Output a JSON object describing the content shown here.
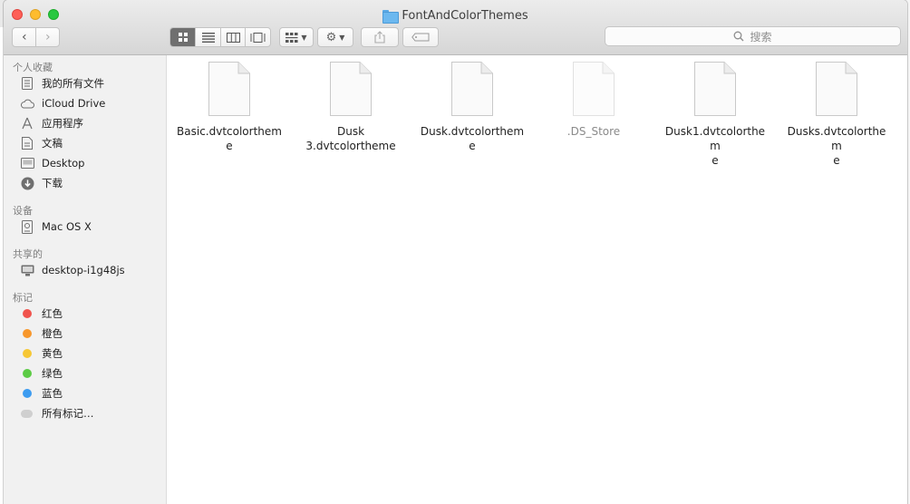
{
  "window": {
    "title": "FontAndColorThemes"
  },
  "toolbar": {
    "back_glyph": "‹",
    "forward_glyph": "›",
    "search_placeholder": "搜索"
  },
  "sidebar": {
    "favorites_header": "个人收藏",
    "favorites": [
      {
        "label": "我的所有文件",
        "icon": "all-files-icon"
      },
      {
        "label": "iCloud Drive",
        "icon": "cloud-icon"
      },
      {
        "label": "应用程序",
        "icon": "applications-icon"
      },
      {
        "label": "文稿",
        "icon": "documents-icon"
      },
      {
        "label": "Desktop",
        "icon": "desktop-icon"
      },
      {
        "label": "下载",
        "icon": "downloads-icon"
      }
    ],
    "devices_header": "设备",
    "devices": [
      {
        "label": "Mac OS X",
        "icon": "disk-icon"
      }
    ],
    "shared_header": "共享的",
    "shared": [
      {
        "label": "desktop-i1g48js",
        "icon": "computer-icon"
      }
    ],
    "tags_header": "标记",
    "tags": [
      {
        "label": "红色",
        "color": "#f0544d"
      },
      {
        "label": "橙色",
        "color": "#f7972c"
      },
      {
        "label": "黄色",
        "color": "#f6c735"
      },
      {
        "label": "绿色",
        "color": "#5ccb45"
      },
      {
        "label": "蓝色",
        "color": "#3d9cf0"
      },
      {
        "label": "所有标记…",
        "color": "#cfcfcf"
      }
    ]
  },
  "files": [
    {
      "name": "Basic.dvtcolorthem\ne",
      "dim": false
    },
    {
      "name": "Dusk\n3.dvtcolortheme",
      "dim": false
    },
    {
      "name": "Dusk.dvtcolorthem\ne",
      "dim": false
    },
    {
      "name": ".DS_Store",
      "dim": true
    },
    {
      "name": "Dusk1.dvtcolorthem\ne",
      "dim": false
    },
    {
      "name": "Dusks.dvtcolorthem\ne",
      "dim": false
    }
  ]
}
